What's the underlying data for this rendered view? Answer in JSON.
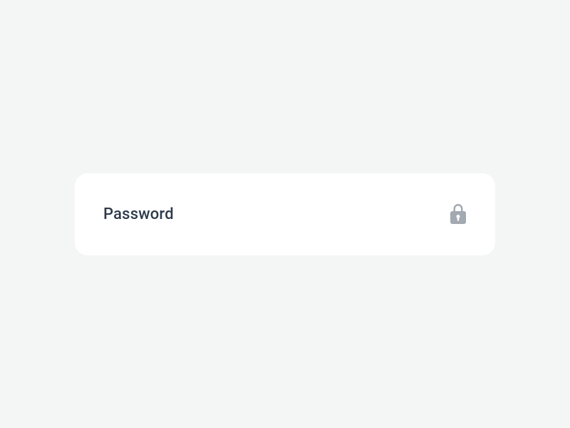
{
  "field": {
    "label": "Password",
    "icon": "lock-icon"
  }
}
